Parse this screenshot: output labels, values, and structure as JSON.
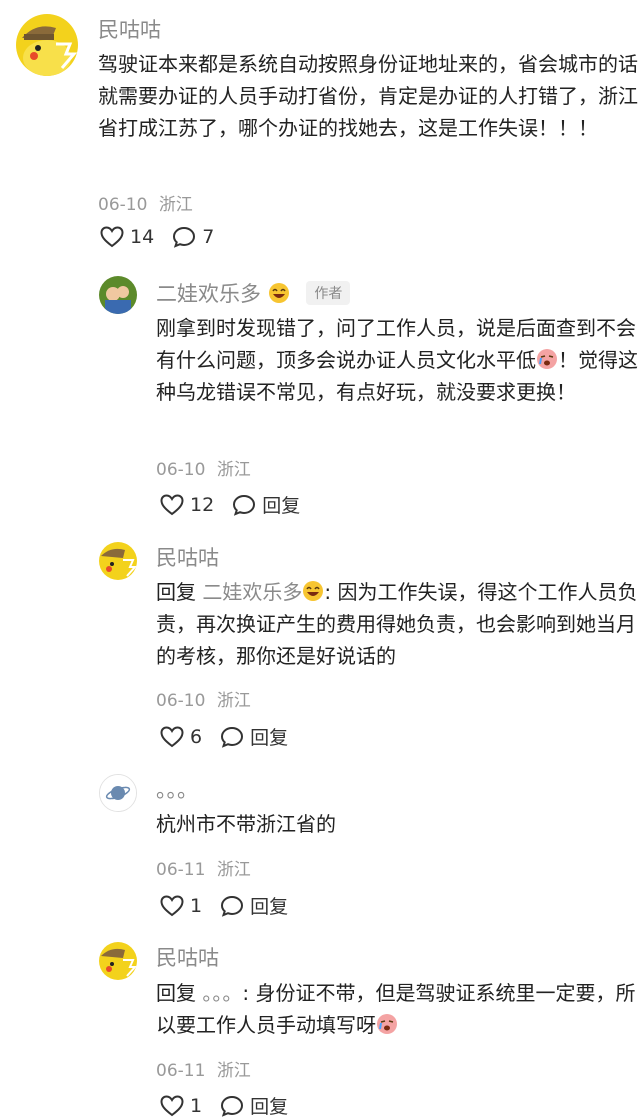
{
  "comments": [
    {
      "username": "民咕咕",
      "text": "驾驶证本来都是系统自动按照身份证地址来的，省会城市的话就需要办证的人员手动打省份，肯定是办证的人打错了，浙江省打成江苏了，哪个办证的找她去，这是工作失误！！！",
      "date": "06-10",
      "location": "浙江",
      "likes": "14",
      "replies_count": "7"
    },
    {
      "username": "二娃欢乐多",
      "author_tag": "作者",
      "text_1": "刚拿到时发现错了，问了工作人员，说是后面查到不会有什么问题，顶多会说办证人员文化水平低",
      "text_2": "！觉得这种乌龙错误不常见，有点好玩，就没要求更换！",
      "date": "06-10",
      "location": "浙江",
      "likes": "12",
      "reply_label": "回复"
    },
    {
      "username": "民咕咕",
      "reply_prefix": "回复",
      "reply_to": "二娃欢乐多",
      "text": ": 因为工作失误，得这个工作人员负责，再次换证产生的费用得她负责，也会影响到她当月的考核，那你还是好说话的",
      "date": "06-10",
      "location": "浙江",
      "likes": "6",
      "reply_label": "回复"
    },
    {
      "username": "。。。",
      "text": "杭州市不带浙江省的",
      "date": "06-11",
      "location": "浙江",
      "likes": "1",
      "reply_label": "回复"
    },
    {
      "username": "民咕咕",
      "reply_prefix": "回复",
      "reply_to": "。。。",
      "text": ": 身份证不带，但是驾驶证系统里一定要，所以要工作人员手动填写呀",
      "date": "06-11",
      "location": "浙江",
      "likes": "1",
      "reply_label": "回复"
    }
  ],
  "icons": {
    "like": "heart-outline-icon",
    "comment": "comment-bubble-icon"
  },
  "colors": {
    "username": "#8a8a8a",
    "meta": "#999999",
    "text": "#222222"
  }
}
